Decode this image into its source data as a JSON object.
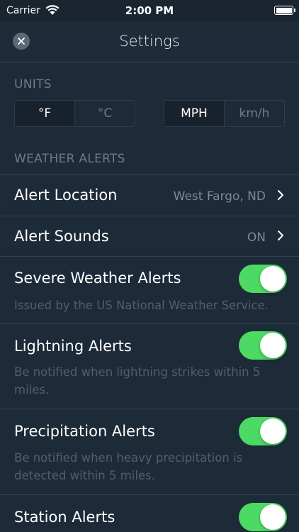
{
  "status_bar": {
    "carrier": "Carrier",
    "time": "2:00 PM"
  },
  "header": {
    "title": "Settings",
    "close_icon": "close-icon"
  },
  "units": {
    "section_title": "UNITS",
    "temperature": {
      "options": [
        "°F",
        "°C"
      ],
      "selected": "°F"
    },
    "speed": {
      "options": [
        "MPH",
        "km/h"
      ],
      "selected": "MPH"
    }
  },
  "weather_alerts": {
    "section_title": "WEATHER ALERTS",
    "alert_location": {
      "label": "Alert Location",
      "value": "West Fargo, ND"
    },
    "alert_sounds": {
      "label": "Alert Sounds",
      "value": "ON"
    },
    "toggles": [
      {
        "label": "Severe Weather Alerts",
        "description": "Issued by the US National Weather Service.",
        "on": true
      },
      {
        "label": "Lightning Alerts",
        "description_lines": [
          "Be notified when lightning strikes within 5",
          "miles."
        ],
        "on": true
      },
      {
        "label": "Precipitation Alerts",
        "description_lines": [
          "Be notified when heavy precipitation is",
          "detected within 5 miles."
        ],
        "on": true
      },
      {
        "label": "Station Alerts",
        "on": true
      }
    ]
  },
  "colors": {
    "background": "#1d2b38",
    "toggle_on": "#4cd964",
    "muted_text": "#6c7b88"
  }
}
